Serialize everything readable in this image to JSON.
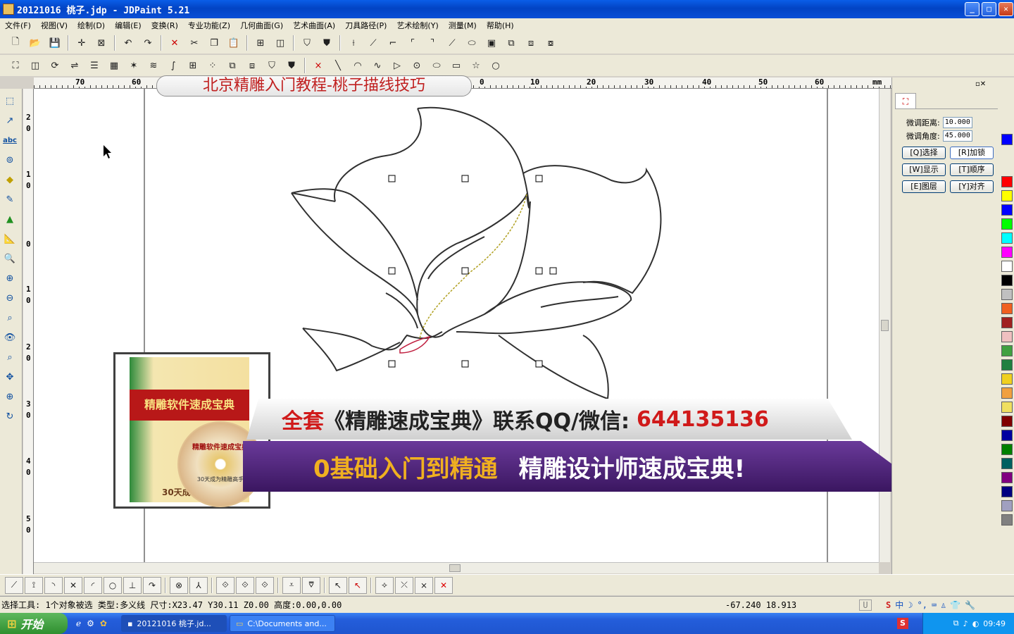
{
  "window": {
    "title": "20121016 桃子.jdp - JDPaint 5.21",
    "min": "_",
    "max": "□",
    "close": "✕"
  },
  "menu": [
    "文件(F)",
    "视图(V)",
    "绘制(D)",
    "编辑(E)",
    "变换(R)",
    "专业功能(Z)",
    "几何曲面(G)",
    "艺术曲面(A)",
    "刀具路径(P)",
    "艺术绘制(Y)",
    "测量(M)",
    "帮助(H)"
  ],
  "hruler": [
    "70",
    "60",
    "0",
    "10",
    "20",
    "30",
    "40",
    "50",
    "60",
    "mm"
  ],
  "vruler": [
    "2",
    "0",
    "1",
    "0",
    "0",
    "1",
    "0",
    "2",
    "0",
    "3",
    "0",
    "4",
    "0",
    "5",
    "0"
  ],
  "banner_title": "北京精雕入门教程-桃子描线技巧",
  "promo": {
    "line1_red": "全套",
    "line1_main": "《精雕速成宝典》联系QQ/微信:",
    "line1_qq": "644135136",
    "line2_gold": "0基础入门到精通",
    "line2_white": "精雕设计师速成宝典!"
  },
  "product": {
    "box_title": "精雕软件速成宝典",
    "disc_title": "精雕软件速成宝典",
    "disc_sub": "30天成为精雕高手",
    "box_bottom": "30天成"
  },
  "panel": {
    "dist_label": "微调距离:",
    "dist_value": "10.000",
    "angle_label": "微调角度:",
    "angle_value": "45.000",
    "buttons": [
      "[Q]选择",
      "[R]加锁",
      "[W]显示",
      "[T]顺序",
      "[E]图层",
      "[Y]对齐"
    ]
  },
  "palette": [
    "#0000ff",
    "#ff0000",
    "#ffff00",
    "#0000ff",
    "#00ff00",
    "#00ffff",
    "#ff00ff",
    "#ffffff",
    "#000000",
    "#c0c0c0",
    "#f06020",
    "#a02020",
    "#f0c0c0",
    "#40a040",
    "#208040",
    "#f0d020",
    "#f0a040",
    "#f0e060",
    "#800000",
    "#0000a0",
    "#008000",
    "#006060",
    "#800080",
    "#000080",
    "#a0a0c0",
    "#808080"
  ],
  "status": {
    "text": "选择工具: 1个对象被选 类型:多义线 尺寸:X23.47 Y30.11 Z0.00 高度:0.00,0.00",
    "coords": "-67.240 18.913",
    "mode": "U"
  },
  "taskbar": {
    "start": "开始",
    "tasks": [
      "20121016 桃子.jd...",
      "C:\\Documents and..."
    ],
    "time": "09:49"
  }
}
